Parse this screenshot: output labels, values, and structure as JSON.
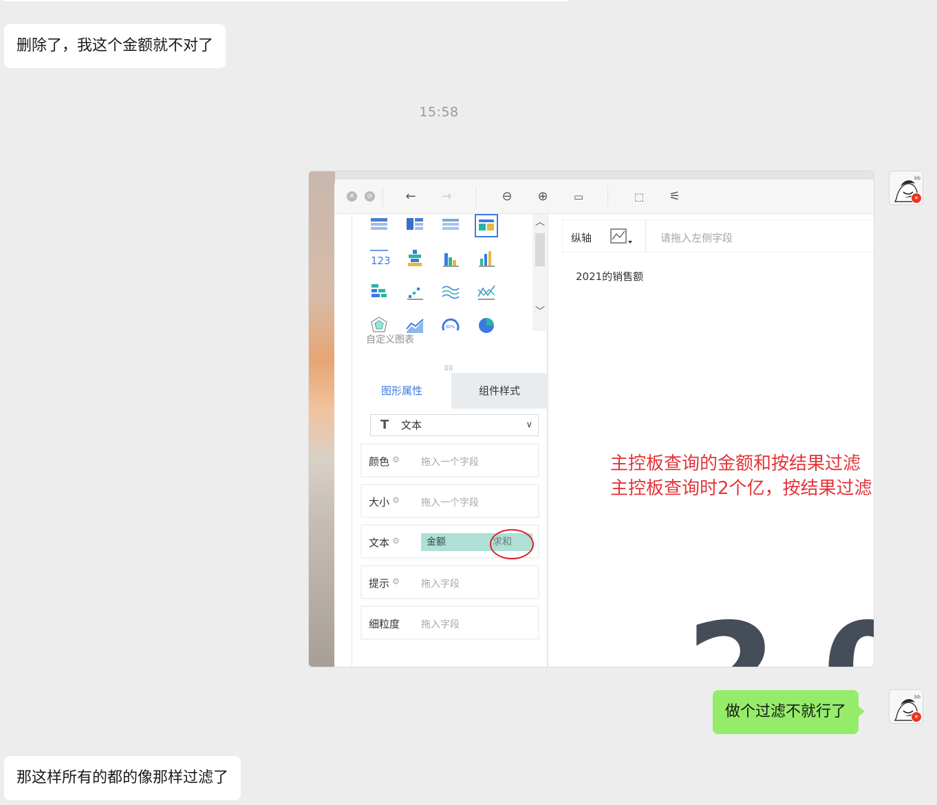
{
  "messages": [
    {
      "side": "left",
      "text": "删除了，我这个金额就不对了"
    },
    {
      "side": "right",
      "text": "做个过滤不就行了"
    },
    {
      "side": "left",
      "text": "那这样所有的都的像那样过滤了"
    }
  ],
  "timestamp": "15:58",
  "screenshot": {
    "toolbar_icons": [
      "close-dot-icon",
      "stop-dot-icon",
      "back-arrow-icon",
      "forward-arrow-icon",
      "zoom-out-icon",
      "zoom-in-icon",
      "fit-screen-icon",
      "rotate-icon",
      "magic-wand-icon"
    ],
    "chart_icons": [
      "table-icon",
      "crosstab-icon",
      "detail-table-icon",
      "colored-table-icon",
      "kpi-number-icon",
      "stacked-bar-icon",
      "grouped-column-icon",
      "column-icon",
      "horizontal-stacked-icon",
      "scatter-step-icon",
      "wave-lines-icon",
      "combo-line-icon",
      "radar-icon",
      "area-line-icon",
      "gauge-icon",
      "pie-icon"
    ],
    "gauge_label": "60%",
    "custom_chart_label": "自定义图表",
    "tab_active": "图形属性",
    "tab_inactive": "组件样式",
    "mark_type": "文本",
    "properties": [
      {
        "name": "颜色",
        "placeholder": "拖入一个字段"
      },
      {
        "name": "大小",
        "placeholder": "拖入一个字段"
      },
      {
        "name": "文本",
        "field": "金额",
        "aggregation": "求和"
      },
      {
        "name": "提示",
        "placeholder": "拖入字段"
      },
      {
        "name": "细粒度",
        "placeholder": "拖入字段"
      }
    ],
    "axis_label": "纵轴",
    "axis_placeholder": "请拖入左侧字段",
    "chart_title": "2021的销售额",
    "annotation_line1": "主控板查询的金额和按结果过滤",
    "annotation_line2": "主控板查询时2个亿，按结果过滤",
    "big_number_fragment": "2 0"
  },
  "colors": {
    "app_background": "#ededed",
    "bubble_left": "#ffffff",
    "bubble_right": "#95ec69",
    "accent_blue": "#3a7be1",
    "annotation_red": "#e3343a"
  }
}
